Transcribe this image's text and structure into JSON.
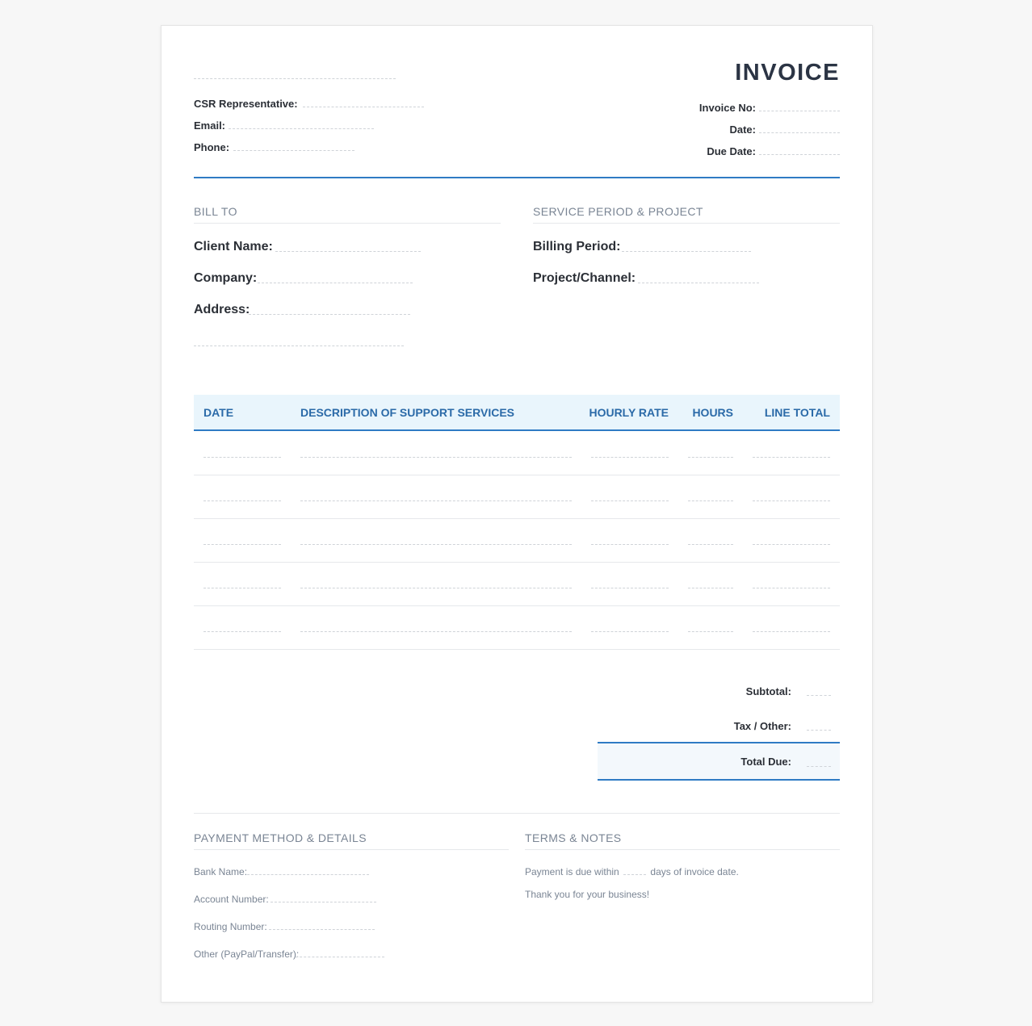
{
  "header": {
    "title": "INVOICE",
    "left_fields": [
      {
        "label": "CSR Representative:"
      },
      {
        "label": "Email:"
      },
      {
        "label": "Phone:"
      }
    ],
    "right_fields": [
      {
        "label": "Invoice No:"
      },
      {
        "label": "Date:"
      },
      {
        "label": "Due Date:"
      }
    ]
  },
  "bill_to": {
    "title": "BILL TO",
    "fields": [
      {
        "label": "Client Name:"
      },
      {
        "label": "Company:"
      },
      {
        "label": "Address:"
      }
    ]
  },
  "service": {
    "title": "SERVICE PERIOD & PROJECT",
    "fields": [
      {
        "label": "Billing Period:"
      },
      {
        "label": "Project/Channel:"
      }
    ]
  },
  "table": {
    "columns": [
      "DATE",
      "DESCRIPTION OF SUPPORT SERVICES",
      "HOURLY RATE",
      "HOURS",
      "LINE TOTAL"
    ],
    "blank_rows": 5
  },
  "totals": {
    "subtotal_label": "Subtotal:",
    "tax_label": "Tax / Other:",
    "total_label": "Total Due:"
  },
  "payment": {
    "title": "PAYMENT METHOD & DETAILS",
    "fields": [
      {
        "label": "Bank Name:"
      },
      {
        "label": "Account Number:"
      },
      {
        "label": "Routing Number:"
      },
      {
        "label": "Other (PayPal/Transfer):"
      }
    ]
  },
  "terms": {
    "title": "TERMS & NOTES",
    "line1_before": "Payment is due within",
    "line1_after": "days of invoice date.",
    "line2": "Thank you for your business!"
  },
  "colors": {
    "accent": "#2f7bc4",
    "header_text": "#2b6aa8",
    "table_header_bg": "#e9f5fc",
    "total_bg": "#f3f8fc"
  }
}
